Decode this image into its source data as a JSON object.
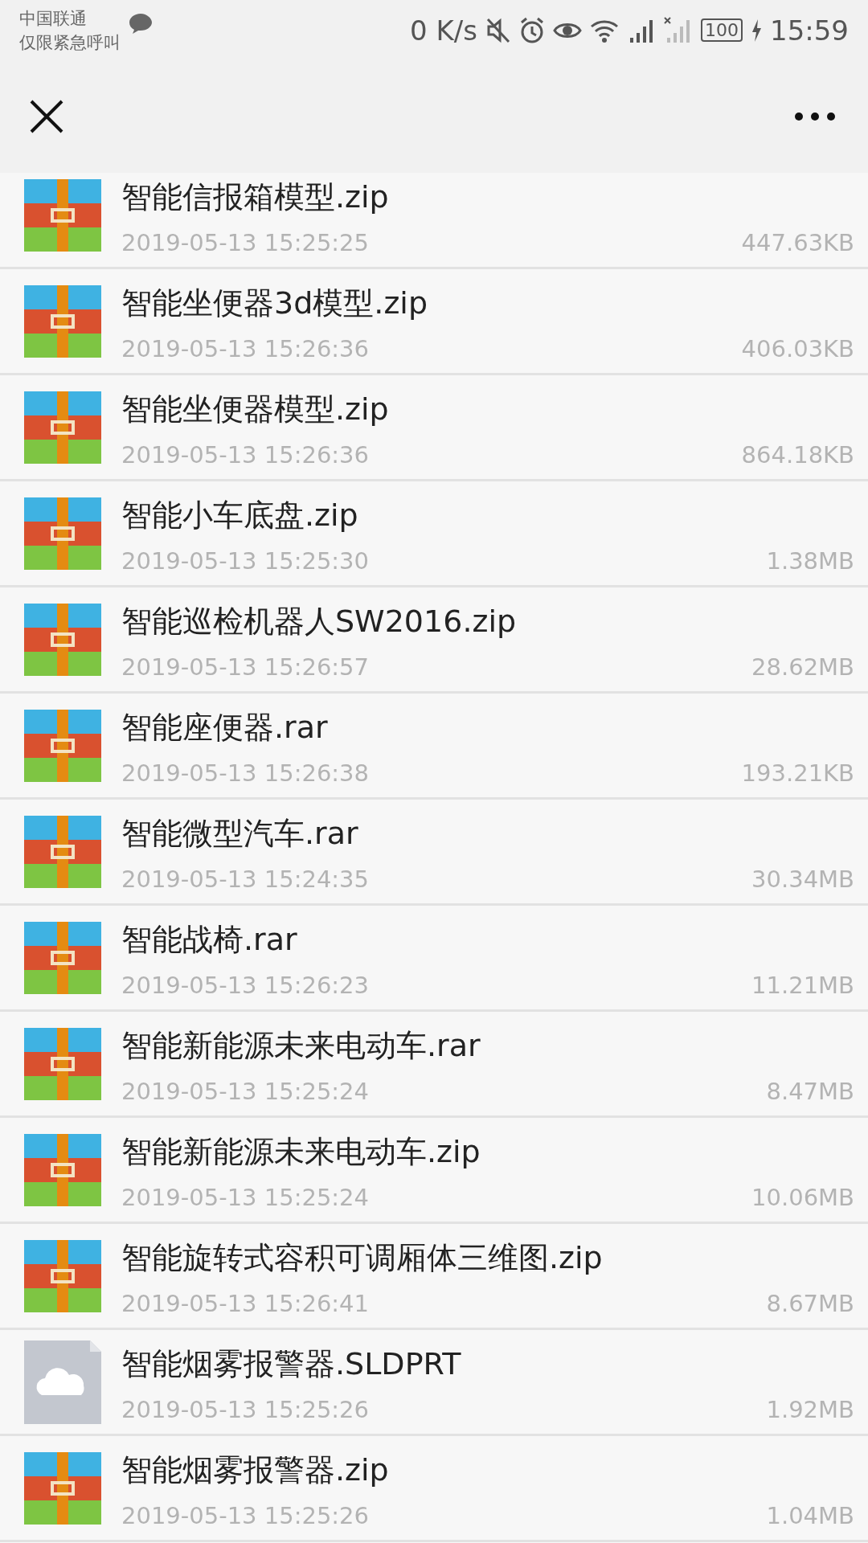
{
  "status_bar": {
    "carrier": "中国联通",
    "carrier_note": "仅限紧急呼叫",
    "speed": "0 K/s",
    "battery": "100",
    "time": "15:59"
  },
  "files": [
    {
      "name": "智能信报箱模型.zip",
      "date": "2019-05-13 15:25:25",
      "size": "447.63KB",
      "kind": "archive"
    },
    {
      "name": "智能坐便器3d模型.zip",
      "date": "2019-05-13 15:26:36",
      "size": "406.03KB",
      "kind": "archive"
    },
    {
      "name": "智能坐便器模型.zip",
      "date": "2019-05-13 15:26:36",
      "size": "864.18KB",
      "kind": "archive"
    },
    {
      "name": "智能小车底盘.zip",
      "date": "2019-05-13 15:25:30",
      "size": "1.38MB",
      "kind": "archive"
    },
    {
      "name": "智能巡检机器人SW2016.zip",
      "date": "2019-05-13 15:26:57",
      "size": "28.62MB",
      "kind": "archive"
    },
    {
      "name": "智能座便器.rar",
      "date": "2019-05-13 15:26:38",
      "size": "193.21KB",
      "kind": "archive"
    },
    {
      "name": "智能微型汽车.rar",
      "date": "2019-05-13 15:24:35",
      "size": "30.34MB",
      "kind": "archive"
    },
    {
      "name": "智能战椅.rar",
      "date": "2019-05-13 15:26:23",
      "size": "11.21MB",
      "kind": "archive"
    },
    {
      "name": "智能新能源未来电动车.rar",
      "date": "2019-05-13 15:25:24",
      "size": "8.47MB",
      "kind": "archive"
    },
    {
      "name": "智能新能源未来电动车.zip",
      "date": "2019-05-13 15:25:24",
      "size": "10.06MB",
      "kind": "archive"
    },
    {
      "name": "智能旋转式容积可调厢体三维图.zip",
      "date": "2019-05-13 15:26:41",
      "size": "8.67MB",
      "kind": "archive"
    },
    {
      "name": "智能烟雾报警器.SLDPRT",
      "date": "2019-05-13 15:25:26",
      "size": "1.92MB",
      "kind": "cloud"
    },
    {
      "name": "智能烟雾报警器.zip",
      "date": "2019-05-13 15:25:26",
      "size": "1.04MB",
      "kind": "archive"
    }
  ]
}
